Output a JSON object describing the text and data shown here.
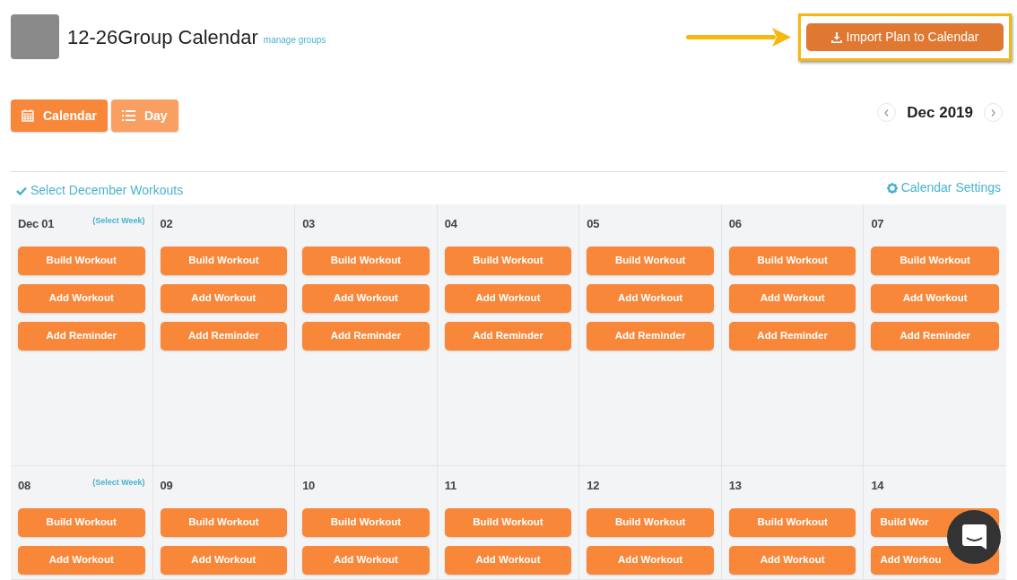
{
  "header": {
    "title": "12-26Group Calendar",
    "manage_link": "manage groups",
    "import_button": "Import Plan to Calendar"
  },
  "views": [
    {
      "kind": "calendar",
      "label": "Calendar",
      "selected": true
    },
    {
      "kind": "list",
      "label": "Day",
      "selected": false
    }
  ],
  "month": "Dec 2019",
  "select_month": "Select December Workouts",
  "settings": "Calendar Settings",
  "weeks": [
    {
      "select_week": "(Select Week)",
      "days": [
        {
          "label": "Dec 01",
          "buttons": [
            "Build Workout",
            "Add Workout",
            "Add Reminder"
          ]
        },
        {
          "label": "02",
          "buttons": [
            "Build Workout",
            "Add Workout",
            "Add Reminder"
          ]
        },
        {
          "label": "03",
          "buttons": [
            "Build Workout",
            "Add Workout",
            "Add Reminder"
          ]
        },
        {
          "label": "04",
          "buttons": [
            "Build Workout",
            "Add Workout",
            "Add Reminder"
          ]
        },
        {
          "label": "05",
          "buttons": [
            "Build Workout",
            "Add Workout",
            "Add Reminder"
          ]
        },
        {
          "label": "06",
          "buttons": [
            "Build Workout",
            "Add Workout",
            "Add Reminder"
          ]
        },
        {
          "label": "07",
          "buttons": [
            "Build Workout",
            "Add Workout",
            "Add Reminder"
          ]
        }
      ]
    },
    {
      "select_week": "(Select Week)",
      "days": [
        {
          "label": "08",
          "buttons": [
            "Build Workout",
            "Add Workout"
          ]
        },
        {
          "label": "09",
          "buttons": [
            "Build Workout",
            "Add Workout"
          ]
        },
        {
          "label": "10",
          "buttons": [
            "Build Workout",
            "Add Workout"
          ]
        },
        {
          "label": "11",
          "buttons": [
            "Build Workout",
            "Add Workout"
          ]
        },
        {
          "label": "12",
          "buttons": [
            "Build Workout",
            "Add Workout"
          ]
        },
        {
          "label": "13",
          "buttons": [
            "Build Workout",
            "Add Workout"
          ]
        },
        {
          "label": "14",
          "covered": true,
          "buttons": [
            "Build Wor",
            "Add Workou"
          ]
        }
      ]
    }
  ]
}
